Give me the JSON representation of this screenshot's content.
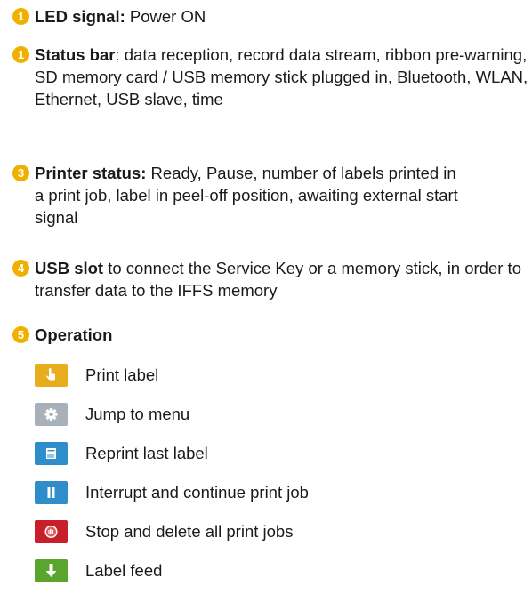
{
  "accent_color": "#f0b000",
  "items": [
    {
      "num": "1",
      "title": "LED signal:",
      "text": " Power ON"
    },
    {
      "num": "1",
      "title": "Status bar",
      "text": ": data reception, record data stream, ribbon pre-warning, SD memory card / USB memory stick plugged in, Bluetooth, WLAN, Ethernet, USB slave, time"
    },
    {
      "num": "3",
      "title": "Printer status:",
      "text": " Ready, Pause, number of labels printed in a print job, label in peel-off position, awaiting external start signal"
    },
    {
      "num": "4",
      "title": "USB slot",
      "text": " to connect the Service Key or a memory stick, in order to transfer data to the IFFS memory"
    },
    {
      "num": "5",
      "title": "Operation",
      "text": ""
    }
  ],
  "operations": [
    {
      "label": "Print label",
      "icon": "hand-pointer-icon",
      "color": "#e8ad1c"
    },
    {
      "label": "Jump to menu",
      "icon": "gear-icon",
      "color": "#a8b1ba"
    },
    {
      "label": "Reprint last label",
      "icon": "reprint-icon",
      "color": "#2f8dc9"
    },
    {
      "label": "Interrupt and continue print job",
      "icon": "pause-icon",
      "color": "#2f8dc9"
    },
    {
      "label": "Stop and delete all print jobs",
      "icon": "stop-hand-icon",
      "color": "#c8202a"
    },
    {
      "label": "Label feed",
      "icon": "arrow-down-icon",
      "color": "#5aa52e"
    }
  ]
}
